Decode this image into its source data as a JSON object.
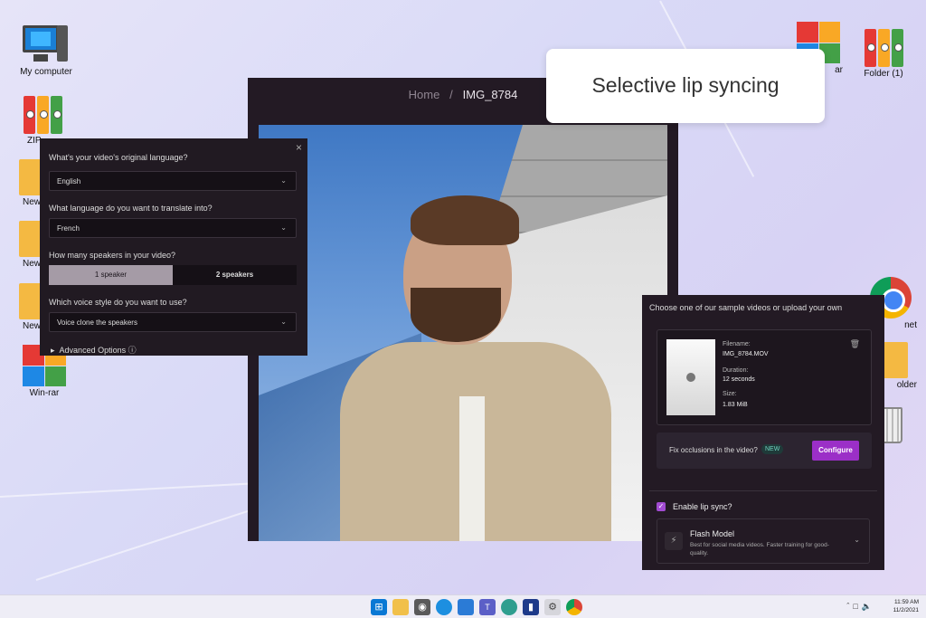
{
  "desktop": {
    "icons": [
      {
        "label": "My computer"
      },
      {
        "label": "ZIP"
      },
      {
        "label": "New"
      },
      {
        "label": "New"
      },
      {
        "label": "New"
      },
      {
        "label": "Win-rar"
      },
      {
        "label": "ar"
      },
      {
        "label": "Folder (1)"
      },
      {
        "label": "net"
      },
      {
        "label": "older"
      }
    ]
  },
  "editor": {
    "breadcrumb": {
      "home": "Home",
      "separator": "/",
      "current": "IMG_8784"
    }
  },
  "feature_label": "Selective lip syncing",
  "language_panel": {
    "close": "×",
    "q_original": "What's your video's original language?",
    "original_value": "English",
    "q_translate": "What language do you want to translate into?",
    "translate_value": "French",
    "q_speakers": "How many speakers in your video?",
    "speaker_options": [
      "1 speaker",
      "2 speakers"
    ],
    "q_voice": "Which voice style do you want to use?",
    "voice_value": "Voice clone the speakers",
    "advanced": "Advanced Options",
    "info_glyph": "ⓘ"
  },
  "upload_panel": {
    "title": "Choose one of our sample videos or upload your own",
    "filename_label": "Filename:",
    "filename": "IMG_8784.MOV",
    "duration_label": "Duration:",
    "duration": "12 seconds",
    "size_label": "Size:",
    "size": "1.83 MiB",
    "occlusion_text": "Fix occlusions in the video?",
    "new_badge": "NEW",
    "configure": "Configure",
    "lip_sync_label": "Enable lip sync?",
    "model_name": "Flash Model",
    "model_desc": "Best for social media videos. Faster training for good-quality."
  },
  "taskbar": {
    "time": "11:59 AM",
    "date": "11/2/2021"
  },
  "colors": {
    "accent": "#9b2fc7",
    "panel": "#231a24",
    "new_badge": "#6fd4c0"
  }
}
